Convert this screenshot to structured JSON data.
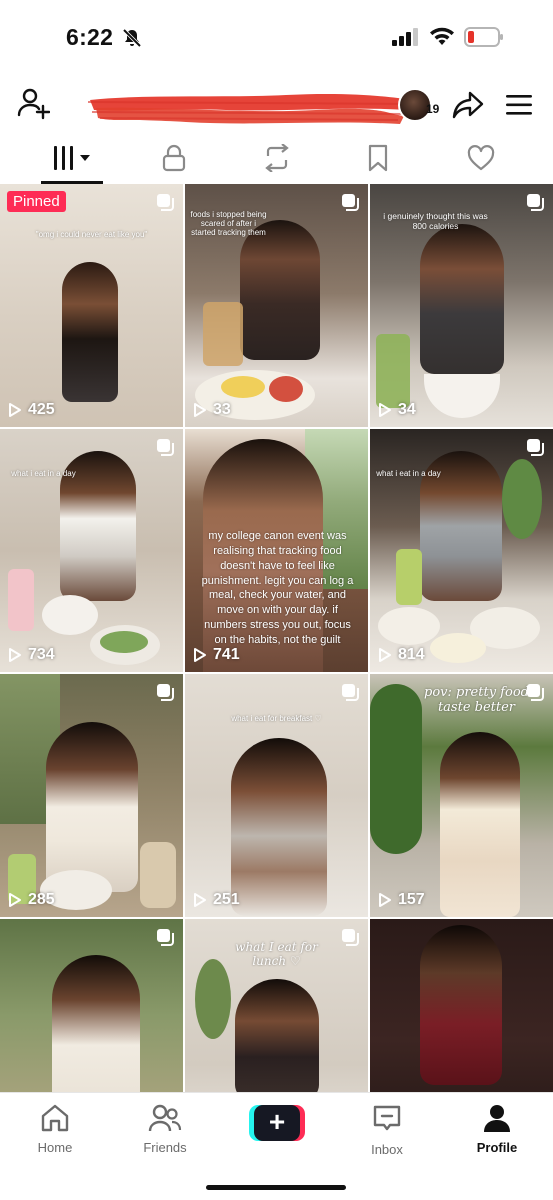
{
  "status_bar": {
    "time": "6:22"
  },
  "header": {
    "avatar_badge": "19"
  },
  "tabs": [
    "videos-icon",
    "lock-icon",
    "repost-icon",
    "bookmark-icon",
    "heart-icon"
  ],
  "tiles": [
    {
      "pinned": "Pinned",
      "caption": "\"omg i could never eat like you\"",
      "views": "425"
    },
    {
      "caption": "foods i stopped being scared of after i started tracking them",
      "views": "33"
    },
    {
      "caption": "i genuinely thought this was 800 calories",
      "views": "34"
    },
    {
      "caption": "what i eat in a day",
      "views": "734"
    },
    {
      "caption": "my college canon event was realising that tracking food doesn't have to feel like punishment. legit you can log a meal, check your water, and move on with your day. if numbers stress you out, focus on the habits, not the guilt",
      "views": "741"
    },
    {
      "caption": "what i eat in a day",
      "views": "814"
    },
    {
      "caption": "",
      "views": "285"
    },
    {
      "caption": "what i eat for breakfast ♡",
      "views": "251"
    },
    {
      "caption": "pov: pretty food taste better",
      "views": "157"
    },
    {
      "caption": "",
      "views": ""
    },
    {
      "caption": "what I eat for lunch ♡",
      "views": ""
    },
    {
      "caption": "",
      "views": ""
    }
  ],
  "bottom_nav": {
    "home": "Home",
    "friends": "Friends",
    "create": "+",
    "inbox": "Inbox",
    "profile": "Profile"
  },
  "colors": {
    "accent": "#fe2c55",
    "cyan": "#25f4ee",
    "dark": "#161823",
    "redaction": "#e53a2e"
  }
}
